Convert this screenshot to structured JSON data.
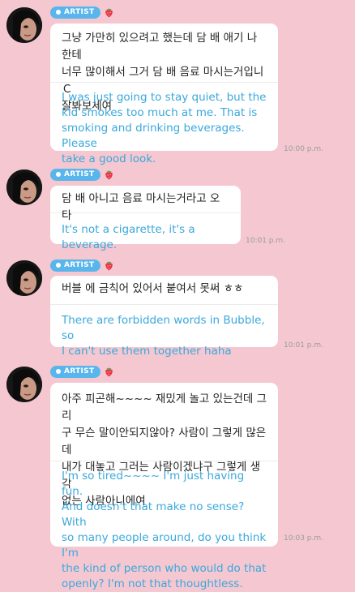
{
  "colors": {
    "background": "#f5c8d1",
    "badge": "#59b6ec",
    "translation_text": "#3aa8dc",
    "bubble": "#ffffff"
  },
  "messages": [
    {
      "badge": "ARTIST",
      "badge_icon": "strawberry-icon",
      "original": "그냥 가만히 있으려고 했는데 담 배 애기 나한테\n너무 많이해서 그거 담 배 음료 마시는거입니Ｃ\n잘봐보세여",
      "translation": "I was just going to stay quiet, but the\nkid smokes too much at me. That is\nsmoking and drinking beverages. Please\ntake a good look.",
      "time": "10:00 p.m."
    },
    {
      "badge": "ARTIST",
      "badge_icon": "strawberry-icon",
      "original": "담 배 아니고 음료 마시는거라고 오타",
      "translation": "It's not a cigarette, it's a beverage.",
      "time": "10:01 p.m."
    },
    {
      "badge": "ARTIST",
      "badge_icon": "strawberry-icon",
      "original": "버블 에 금칙어 있어서 붙여서 못써 ㅎㅎ",
      "translation": "There are forbidden words in Bubble, so\nI can't use them together haha",
      "time": "10:01 p.m."
    },
    {
      "badge": "ARTIST",
      "badge_icon": "strawberry-icon",
      "original": "아주 피곤해~~~~ 재밌게 놀고 있는건데 그리\n구 무슨 말이안되지않아? 사람이 그렇게 많은데\n내가 대놓고 그러는 사람이겠냐구 그렇게 생각\n없는 사람아니에여",
      "translation": "I'm so tired~~~~ I'm just having fun.\nAnd doesn't that make no sense? With\nso many people around, do you think I'm\nthe kind of person who would do that\nopenly? I'm not that thoughtless.",
      "time": "10:03 p.m."
    }
  ]
}
